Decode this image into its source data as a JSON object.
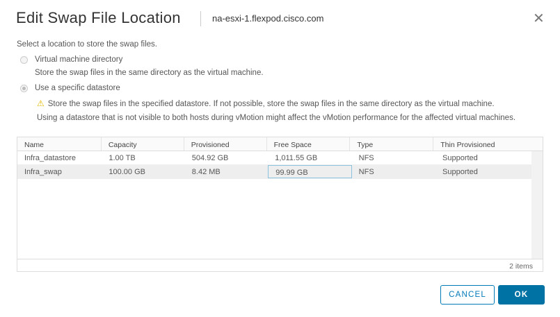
{
  "dialog": {
    "title": "Edit Swap File Location",
    "host": "na-esxi-1.flexpod.cisco.com",
    "close_icon": "close-icon"
  },
  "prompt": "Select a location to store the swap files.",
  "options": [
    {
      "label": "Virtual machine directory",
      "description": "Store the swap files in the same directory as the virtual machine.",
      "selected": false
    },
    {
      "label": "Use a specific datastore",
      "description": "Store the swap files in the specified datastore. If not possible, store the swap files in the same directory as the virtual machine. Using a datastore that is not visible to both hosts during vMotion might affect the vMotion performance for the affected virtual machines.",
      "selected": true
    }
  ],
  "table": {
    "columns": [
      "Name",
      "Capacity",
      "Provisioned",
      "Free Space",
      "Type",
      "Thin Provisioned"
    ],
    "rows": [
      [
        "Infra_datastore",
        "1.00 TB",
        "504.92 GB",
        "1,011.55 GB",
        "NFS",
        "Supported"
      ],
      [
        "Infra_swap",
        "100.00 GB",
        "8.42 MB",
        "99.99 GB",
        "NFS",
        "Supported"
      ]
    ],
    "selected_row": 1,
    "footer": "2 items"
  },
  "buttons": {
    "cancel": "CANCEL",
    "ok": "OK"
  },
  "colors": {
    "primary": "#0072a3",
    "warning": "#e6b800"
  }
}
